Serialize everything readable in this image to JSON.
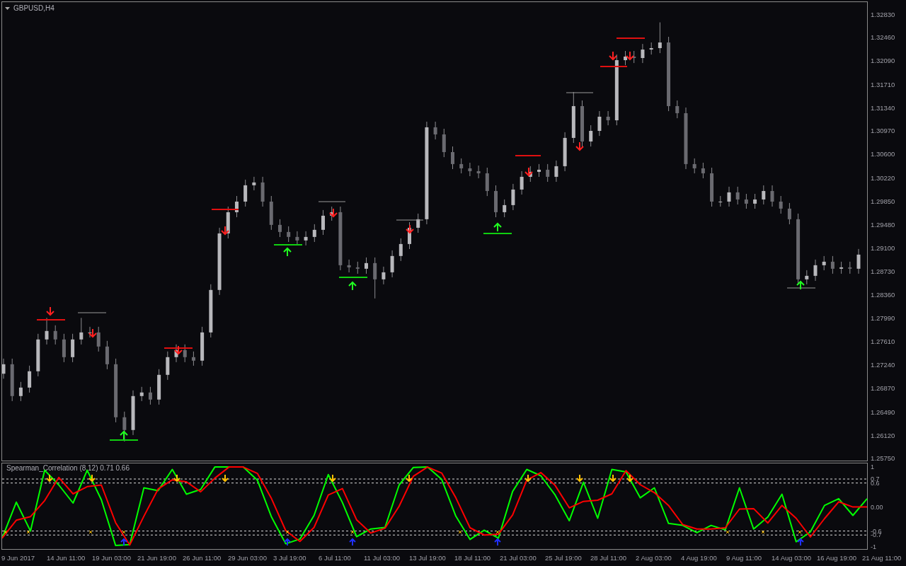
{
  "chart": {
    "title": "GBPUSD,H4",
    "chart_data": {
      "type": "candlestick",
      "ylim": [
        1.25727,
        1.33022
      ],
      "yticks": [
        {
          "value": 1.3283,
          "label": "1.32830"
        },
        {
          "value": 1.3246,
          "label": "1.32460"
        },
        {
          "value": 1.3209,
          "label": "1.32090"
        },
        {
          "value": 1.3171,
          "label": "1.31710"
        },
        {
          "value": 1.3134,
          "label": "1.31340"
        },
        {
          "value": 1.3097,
          "label": "1.30970"
        },
        {
          "value": 1.306,
          "label": "1.30600"
        },
        {
          "value": 1.3022,
          "label": "1.30220"
        },
        {
          "value": 1.2985,
          "label": "1.29850"
        },
        {
          "value": 1.2948,
          "label": "1.29480"
        },
        {
          "value": 1.291,
          "label": "1.29100"
        },
        {
          "value": 1.2873,
          "label": "1.28730"
        },
        {
          "value": 1.2836,
          "label": "1.28360"
        },
        {
          "value": 1.2799,
          "label": "1.27990"
        },
        {
          "value": 1.2761,
          "label": "1.27610"
        },
        {
          "value": 1.2724,
          "label": "1.27240"
        },
        {
          "value": 1.2687,
          "label": "1.26870"
        },
        {
          "value": 1.2649,
          "label": "1.26490"
        },
        {
          "value": 1.2612,
          "label": "1.26120"
        },
        {
          "value": 1.2575,
          "label": "1.25750"
        }
      ],
      "ohlc": [
        [
          1.271,
          1.27341,
          1.2702,
          1.27251
        ],
        [
          1.27251,
          1.2734,
          1.26664,
          1.26744
        ],
        [
          1.26744,
          1.26969,
          1.26664,
          1.26879
        ],
        [
          1.26879,
          1.27229,
          1.26799,
          1.27139
        ],
        [
          1.27139,
          1.27736,
          1.27059,
          1.27646
        ],
        [
          1.27646,
          1.27991,
          1.27566,
          1.27781
        ],
        [
          1.27781,
          1.27871,
          1.27566,
          1.27646
        ],
        [
          1.27646,
          1.27736,
          1.27284,
          1.27364
        ],
        [
          1.27364,
          1.27736,
          1.27284,
          1.27646
        ],
        [
          1.27646,
          1.2799,
          1.27566,
          1.27758
        ],
        [
          1.27758,
          1.27848,
          1.27678,
          1.27758
        ],
        [
          1.27758,
          1.27848,
          1.27453,
          1.27533
        ],
        [
          1.27533,
          1.27623,
          1.27171,
          1.27251
        ],
        [
          1.27251,
          1.27341,
          1.26326,
          1.26406
        ],
        [
          1.26406,
          1.26496,
          1.2602,
          1.26203
        ],
        [
          1.26203,
          1.26834,
          1.26123,
          1.26744
        ],
        [
          1.26744,
          1.26891,
          1.26664,
          1.26801
        ],
        [
          1.26801,
          1.26891,
          1.26608,
          1.26688
        ],
        [
          1.26688,
          1.27172,
          1.26608,
          1.27082
        ],
        [
          1.27082,
          1.27454,
          1.27002,
          1.27364
        ],
        [
          1.27364,
          1.27567,
          1.27284,
          1.27477
        ],
        [
          1.27477,
          1.27567,
          1.27284,
          1.27364
        ],
        [
          1.27364,
          1.27454,
          1.27228,
          1.27308
        ],
        [
          1.27308,
          1.27848,
          1.27228,
          1.27758
        ],
        [
          1.27758,
          1.28525,
          1.27678,
          1.28435
        ],
        [
          1.28435,
          1.29426,
          1.28355,
          1.29336
        ],
        [
          1.29336,
          1.29764,
          1.29256,
          1.29674
        ],
        [
          1.29674,
          1.29933,
          1.29594,
          1.29843
        ],
        [
          1.29843,
          1.30193,
          1.29763,
          1.30103
        ],
        [
          1.30103,
          1.30238,
          1.30023,
          1.30148
        ],
        [
          1.30148,
          1.30238,
          1.29763,
          1.29843
        ],
        [
          1.29843,
          1.29933,
          1.29392,
          1.29472
        ],
        [
          1.29472,
          1.29562,
          1.29279,
          1.29359
        ],
        [
          1.29359,
          1.29449,
          1.292,
          1.2928
        ],
        [
          1.2928,
          1.2937,
          1.29144,
          1.29224
        ],
        [
          1.29224,
          1.2937,
          1.29144,
          1.2928
        ],
        [
          1.2928,
          1.29483,
          1.292,
          1.29393
        ],
        [
          1.29393,
          1.29708,
          1.29313,
          1.29618
        ],
        [
          1.29618,
          1.29764,
          1.29538,
          1.29674
        ],
        [
          1.29674,
          1.29764,
          1.28749,
          1.28829
        ],
        [
          1.28829,
          1.28919,
          1.28715,
          1.28795
        ],
        [
          1.28795,
          1.28885,
          1.28693,
          1.28773
        ],
        [
          1.28773,
          1.28953,
          1.28693,
          1.28863
        ],
        [
          1.28863,
          1.28953,
          1.283,
          1.28604
        ],
        [
          1.28604,
          1.28806,
          1.28524,
          1.28716
        ],
        [
          1.28716,
          1.29066,
          1.28636,
          1.28976
        ],
        [
          1.28976,
          1.29257,
          1.28896,
          1.29167
        ],
        [
          1.29167,
          1.29516,
          1.29087,
          1.29426
        ],
        [
          1.29426,
          1.29652,
          1.29346,
          1.29562
        ],
        [
          1.29562,
          1.31117,
          1.29482,
          1.31027
        ],
        [
          1.31027,
          1.31117,
          1.30834,
          1.30914
        ],
        [
          1.30914,
          1.31004,
          1.30552,
          1.30632
        ],
        [
          1.30632,
          1.30722,
          1.30361,
          1.30441
        ],
        [
          1.30441,
          1.30531,
          1.30293,
          1.30373
        ],
        [
          1.30373,
          1.30463,
          1.30248,
          1.30328
        ],
        [
          1.30328,
          1.30418,
          1.30214,
          1.30294
        ],
        [
          1.30294,
          1.30384,
          1.29932,
          1.30012
        ],
        [
          1.30012,
          1.30102,
          1.29594,
          1.29674
        ],
        [
          1.29674,
          1.29877,
          1.29594,
          1.29787
        ],
        [
          1.29787,
          1.30125,
          1.29707,
          1.30035
        ],
        [
          1.30035,
          1.30328,
          1.29955,
          1.30238
        ],
        [
          1.30238,
          1.30407,
          1.30158,
          1.30317
        ],
        [
          1.30317,
          1.30441,
          1.30237,
          1.30351
        ],
        [
          1.30351,
          1.30441,
          1.30158,
          1.30238
        ],
        [
          1.30238,
          1.30497,
          1.30158,
          1.30407
        ],
        [
          1.30407,
          1.30948,
          1.30327,
          1.30858
        ],
        [
          1.30858,
          1.3159,
          1.30778,
          1.31365
        ],
        [
          1.31365,
          1.31455,
          1.30721,
          1.30801
        ],
        [
          1.30801,
          1.3106,
          1.30721,
          1.3097
        ],
        [
          1.3097,
          1.31286,
          1.3089,
          1.31196
        ],
        [
          1.31196,
          1.31286,
          1.31059,
          1.31139
        ],
        [
          1.31139,
          1.32187,
          1.31059,
          1.32097
        ],
        [
          1.32097,
          1.32244,
          1.32017,
          1.32154
        ],
        [
          1.32154,
          1.32244,
          1.32051,
          1.32131
        ],
        [
          1.32131,
          1.32356,
          1.32051,
          1.32266
        ],
        [
          1.32266,
          1.32379,
          1.32186,
          1.32289
        ],
        [
          1.32289,
          1.327,
          1.32209,
          1.32379
        ],
        [
          1.32379,
          1.32469,
          1.31285,
          1.31365
        ],
        [
          1.31365,
          1.31455,
          1.31172,
          1.31252
        ],
        [
          1.31252,
          1.31342,
          1.30361,
          1.30441
        ],
        [
          1.30441,
          1.30531,
          1.30293,
          1.30373
        ],
        [
          1.30373,
          1.30463,
          1.30214,
          1.30294
        ],
        [
          1.30294,
          1.30384,
          1.29763,
          1.29843
        ],
        [
          1.29843,
          1.29933,
          1.29763,
          1.29843
        ],
        [
          1.29843,
          1.3008,
          1.29763,
          1.2999
        ],
        [
          1.2999,
          1.3008,
          1.29797,
          1.29877
        ],
        [
          1.29877,
          1.29967,
          1.2973,
          1.2981
        ],
        [
          1.2981,
          1.29967,
          1.2973,
          1.29877
        ],
        [
          1.29877,
          1.30102,
          1.29797,
          1.30012
        ],
        [
          1.30012,
          1.30102,
          1.29763,
          1.29843
        ],
        [
          1.29843,
          1.29933,
          1.29651,
          1.29731
        ],
        [
          1.29731,
          1.29821,
          1.29482,
          1.29562
        ],
        [
          1.29562,
          1.29652,
          1.28524,
          1.28604
        ],
        [
          1.28604,
          1.2875,
          1.28524,
          1.2866
        ],
        [
          1.2866,
          1.28919,
          1.2858,
          1.28829
        ],
        [
          1.28829,
          1.28975,
          1.28749,
          1.28885
        ],
        [
          1.28885,
          1.28975,
          1.28693,
          1.28773
        ],
        [
          1.28773,
          1.28885,
          1.28693,
          1.28795
        ],
        [
          1.28795,
          1.28885,
          1.28693,
          1.28773
        ],
        [
          1.28773,
          1.29088,
          1.28693,
          1.28998
        ]
      ]
    }
  },
  "indicator": {
    "label": "Spearman_Correlation (8,12) 0.71 0.66",
    "chart_data": {
      "type": "line",
      "grid": true,
      "ylim": [
        -1.05,
        1.09
      ],
      "yticks": [
        {
          "value": 1,
          "label": "1"
        },
        {
          "value": 0.7,
          "label": "0.7"
        },
        {
          "value": 0.6,
          "label": "0.6"
        },
        {
          "value": 0,
          "label": "0.00"
        },
        {
          "value": -0.6,
          "label": "-0.6"
        },
        {
          "value": -0.7,
          "label": "-0.7"
        },
        {
          "value": -1,
          "label": "-1"
        }
      ],
      "series": [
        {
          "color": "#00ff00",
          "values": [
            -0.78,
            0.12,
            -0.6,
            0.92,
            0.55,
            0.1,
            0.92,
            0.18,
            -0.96,
            -0.94,
            0.48,
            0.41,
            0.94,
            0.32,
            0.44,
            1,
            1,
            1,
            0.67,
            -0.25,
            -0.92,
            -0.8,
            -0.21,
            0.81,
            0.11,
            -0.74,
            -0.55,
            -0.51,
            0.55,
            0.99,
            1,
            0.69,
            -0.23,
            -0.81,
            -0.58,
            -0.78,
            0.39,
            0.94,
            0.78,
            0.3,
            -0.34,
            0.62,
            -0.28,
            0.94,
            0.88,
            0.23,
            0.48,
            -0.41,
            -0.46,
            -0.64,
            -0.46,
            -0.57,
            0.48,
            -0.55,
            -0.25,
            0.32,
            -0.87,
            -0.62,
            0.04,
            0.21,
            -0.21,
            0.21
          ]
        },
        {
          "color": "#ff0000",
          "values": [
            -0.78,
            -0.33,
            -0.24,
            0.16,
            0.74,
            0.33,
            0.51,
            0.55,
            -0.39,
            -0.95,
            -0.23,
            0.45,
            0.68,
            0.63,
            0.38,
            0.72,
            1,
            1,
            0.84,
            0.21,
            -0.59,
            -0.86,
            -0.51,
            0.3,
            0.46,
            -0.32,
            -0.65,
            -0.53,
            0.02,
            0.77,
            1,
            0.85,
            0.23,
            -0.52,
            -0.7,
            -0.68,
            -0.2,
            0.67,
            0.86,
            0.54,
            -0.02,
            0.14,
            0.17,
            0.33,
            0.91,
            0.56,
            0.36,
            0.04,
            -0.44,
            -0.55,
            -0.55,
            -0.52,
            -0.05,
            -0.04,
            -0.4,
            0.04,
            -0.28,
            -0.75,
            -0.29,
            0.13,
            0,
            0
          ]
        }
      ]
    }
  },
  "time_axis": [
    "9 Jun 2017",
    "14 Jun 11:00",
    "19 Jun 03:00",
    "21 Jun 19:00",
    "26 Jun 11:00",
    "29 Jun 03:00",
    "3 Jul 19:00",
    "6 Jul 11:00",
    "11 Jul 03:00",
    "13 Jul 19:00",
    "18 Jul 11:00",
    "21 Jul 03:00",
    "25 Jul 19:00",
    "28 Jul 11:00",
    "2 Aug 03:00",
    "4 Aug 19:00",
    "9 Aug 11:00",
    "14 Aug 03:00",
    "16 Aug 19:00",
    "21 Aug 11:00"
  ]
}
